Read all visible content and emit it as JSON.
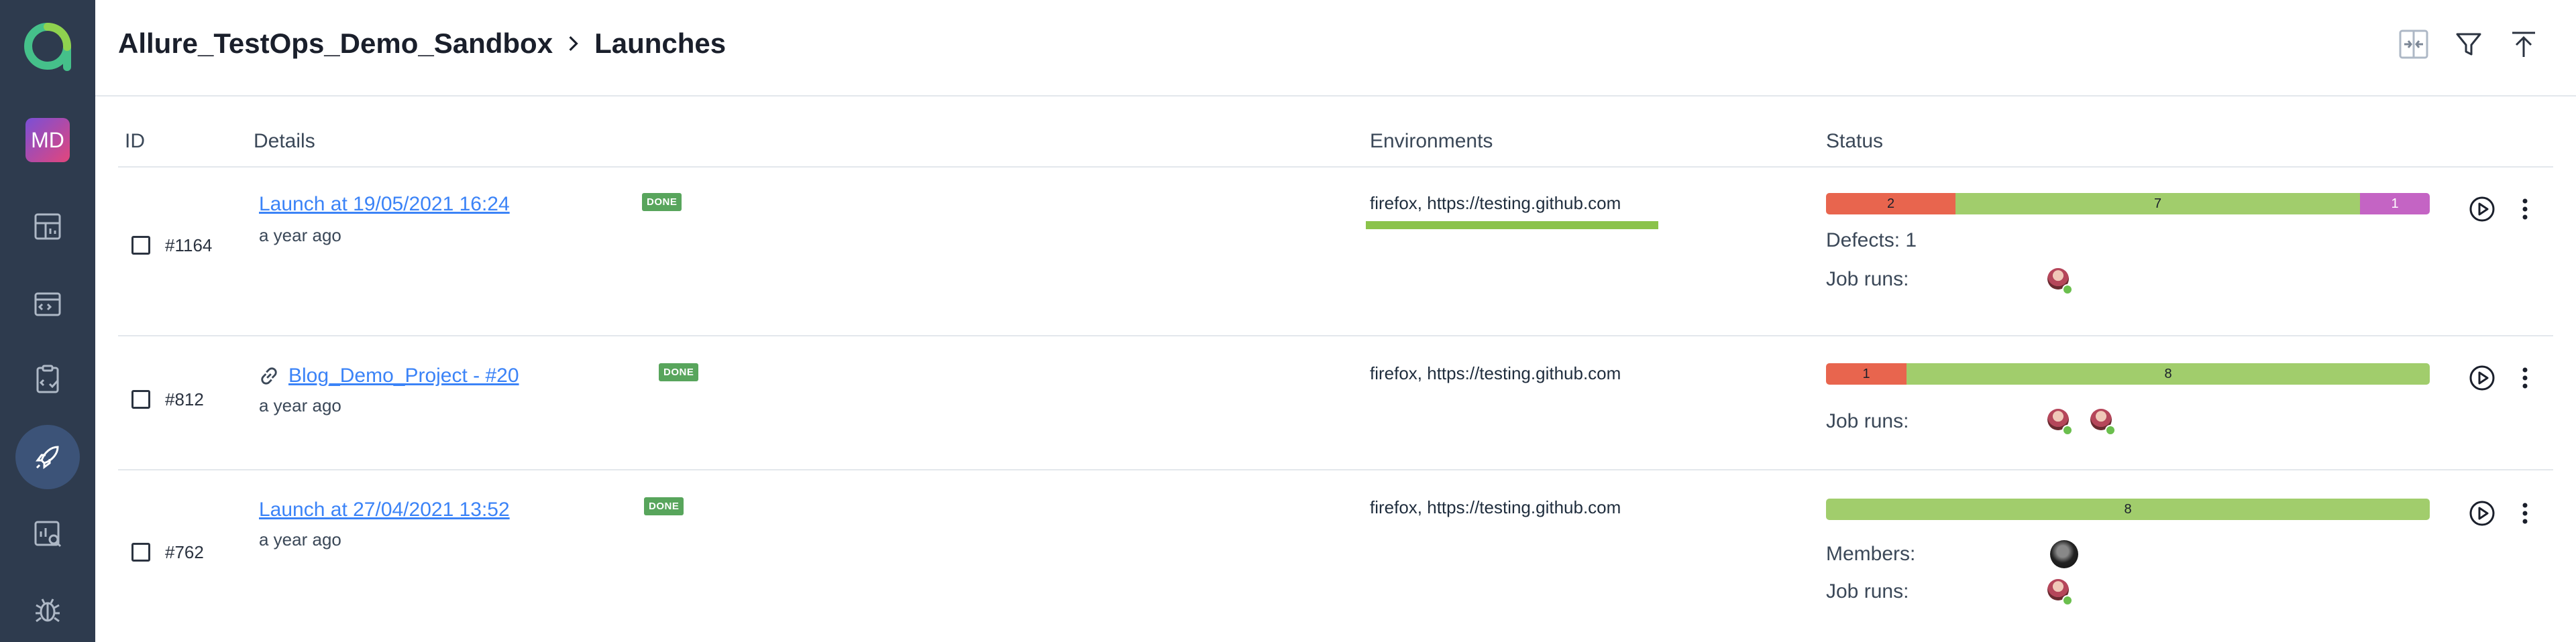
{
  "sidebar": {
    "avatar_initials": "MD",
    "items": [
      {
        "name": "dashboard-icon"
      },
      {
        "name": "test-cases-icon"
      },
      {
        "name": "test-plans-icon"
      },
      {
        "name": "launches-icon",
        "active": true
      },
      {
        "name": "analytics-icon"
      },
      {
        "name": "defects-icon"
      }
    ]
  },
  "header": {
    "project": "Allure_TestOps_Demo_Sandbox",
    "page": "Launches",
    "actions": [
      "compare-icon",
      "filter-icon",
      "upload-icon"
    ]
  },
  "table": {
    "columns": {
      "id": "ID",
      "details": "Details",
      "environments": "Environments",
      "status": "Status"
    },
    "rows": [
      {
        "id": "#1164",
        "name": "Launch at 19/05/2021 16:24",
        "badge": "DONE",
        "time": "a year ago",
        "environment": "firefox, https://testing.github.com",
        "status": {
          "failed": "2",
          "passed": "7",
          "broken": "1"
        },
        "defects_label": "Defects: 1",
        "job_runs_label": "Job runs:"
      },
      {
        "id": "#812",
        "name": "Blog_Demo_Project - #20",
        "badge": "DONE",
        "time": "a year ago",
        "environment": "firefox, https://testing.github.com",
        "status": {
          "failed": "1",
          "passed": "8"
        },
        "job_runs_label": "Job runs:"
      },
      {
        "id": "#762",
        "name": "Launch at 27/04/2021 13:52",
        "badge": "DONE",
        "time": "a year ago",
        "environment": "firefox, https://testing.github.com",
        "status": {
          "passed": "8"
        },
        "members_label": "Members:",
        "job_runs_label": "Job runs:"
      }
    ]
  },
  "colors": {
    "sidebar_bg": "#2e3b4e",
    "failed": "#e8654e",
    "passed": "#a1cd6c",
    "broken": "#c464c4",
    "done_badge": "#58a55c",
    "link": "#3b83f7"
  }
}
